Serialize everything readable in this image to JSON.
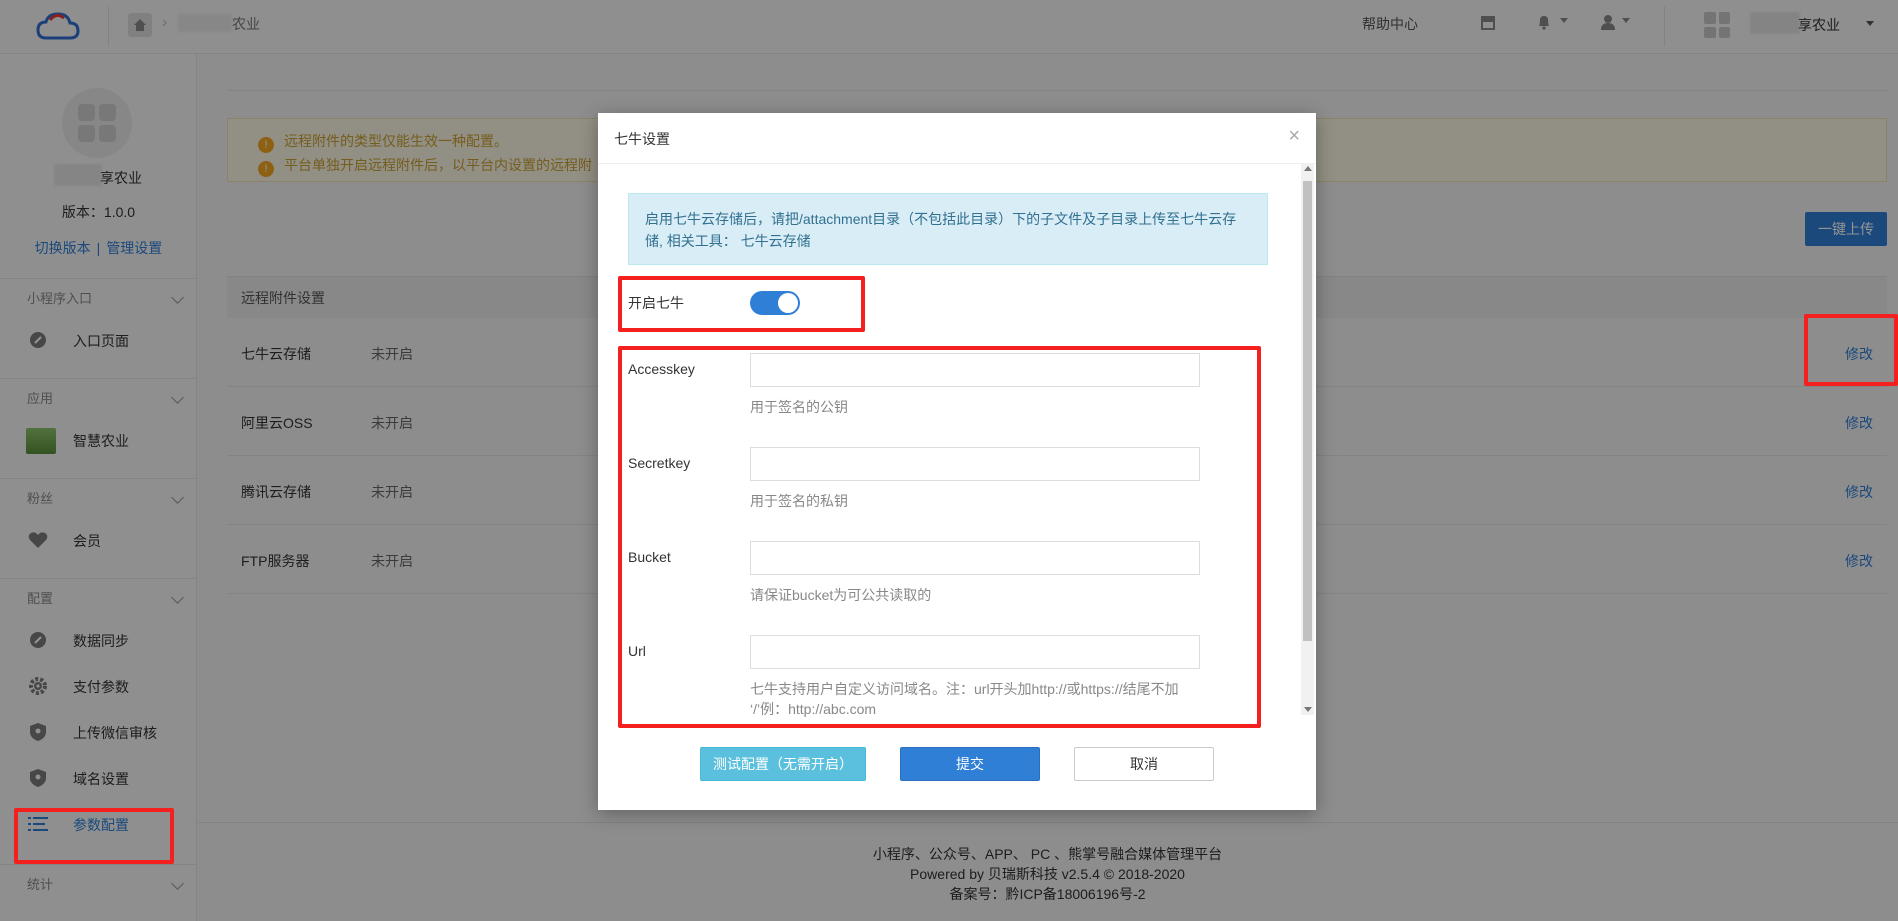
{
  "topbar": {
    "breadcrumb_suffix": "农业",
    "help": "帮助中心",
    "account_suffix": "享农业"
  },
  "sidebar": {
    "app_name_suffix": "享农业",
    "version": "版本：1.0.0",
    "switch_version": "切换版本",
    "link_sep": "|",
    "manage": "管理设置",
    "groups": {
      "mini": "小程序入口",
      "app": "应用",
      "fans": "粉丝",
      "config": "配置",
      "stats": "统计"
    },
    "items": {
      "entry": "入口页面",
      "agri": "智慧农业",
      "member": "会员",
      "sync": "数据同步",
      "pay": "支付参数",
      "wx_review": "上传微信审核",
      "domain": "域名设置",
      "params": "参数配置"
    }
  },
  "main": {
    "notices": [
      "远程附件的类型仅能生效一种配置。",
      "平台单独开启远程附件后，以平台内设置的远程附"
    ],
    "upload_all": "一键上传",
    "table_header": "远程附件设置",
    "rows": [
      {
        "name": "七牛云存储",
        "status": "未开启",
        "action": "修改"
      },
      {
        "name": "阿里云OSS",
        "status": "未开启",
        "action": "修改"
      },
      {
        "name": "腾讯云存储",
        "status": "未开启",
        "action": "修改"
      },
      {
        "name": "FTP服务器",
        "status": "未开启",
        "action": "修改"
      }
    ]
  },
  "footer": {
    "line1": "小程序、公众号、APP、 PC 、熊掌号融合媒体管理平台",
    "line2": "Powered by 贝瑞斯科技 v2.5.4 © 2018-2020",
    "line3": "备案号：黔ICP备18006196号-2"
  },
  "modal": {
    "title": "七牛设置",
    "close": "×",
    "info": "启用七牛云存储后，请把/attachment目录（不包括此目录）下的子文件及子目录上传至七牛云存储, 相关工具： 七牛云存储",
    "enable_label": "开启七牛",
    "enable_on": true,
    "fields": {
      "accesskey": {
        "label": "Accesskey",
        "value": "",
        "help": "用于签名的公钥"
      },
      "secretkey": {
        "label": "Secretkey",
        "value": "",
        "help": "用于签名的私钥"
      },
      "bucket": {
        "label": "Bucket",
        "value": "",
        "help": "请保证bucket为可公共读取的"
      },
      "url": {
        "label": "Url",
        "value": "",
        "help": "七牛支持用户自定义访问域名。注：url开头加http://或https://结尾不加 ‘/’例：http://abc.com"
      }
    },
    "buttons": {
      "test": "测试配置（无需开启）",
      "submit": "提交",
      "cancel": "取消"
    }
  },
  "colors": {
    "accent": "#2f7fd6",
    "highlight": "#f41f1f",
    "info_bg": "#d9edf7",
    "warning_text": "#c9a135"
  }
}
